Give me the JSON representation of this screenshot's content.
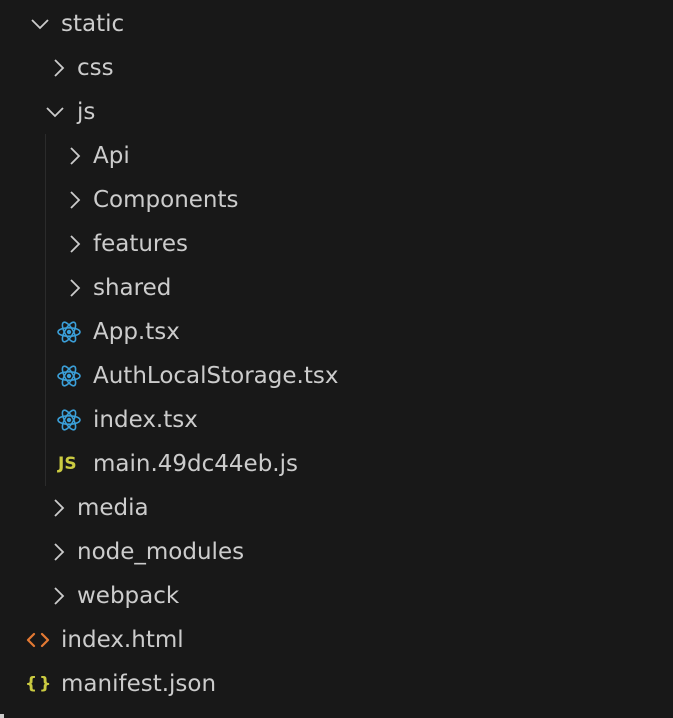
{
  "explorer": {
    "colors": {
      "background": "#181818",
      "text": "#cccccc",
      "react_icon": "#3b9fd8",
      "js_icon": "#cbcb41",
      "html_icon": "#e37933",
      "json_icon": "#cbcb41"
    },
    "items": [
      {
        "label": "static",
        "kind": "folder",
        "state": "expanded"
      },
      {
        "label": "css",
        "kind": "folder",
        "state": "collapsed"
      },
      {
        "label": "js",
        "kind": "folder",
        "state": "expanded"
      },
      {
        "label": "Api",
        "kind": "folder",
        "state": "collapsed"
      },
      {
        "label": "Components",
        "kind": "folder",
        "state": "collapsed"
      },
      {
        "label": "features",
        "kind": "folder",
        "state": "collapsed"
      },
      {
        "label": "shared",
        "kind": "folder",
        "state": "collapsed"
      },
      {
        "label": "App.tsx",
        "kind": "file",
        "icon": "react-icon"
      },
      {
        "label": "AuthLocalStorage.tsx",
        "kind": "file",
        "icon": "react-icon"
      },
      {
        "label": "index.tsx",
        "kind": "file",
        "icon": "react-icon"
      },
      {
        "label": "main.49dc44eb.js",
        "kind": "file",
        "icon": "js-icon",
        "icon_text": "JS"
      },
      {
        "label": "media",
        "kind": "folder",
        "state": "collapsed"
      },
      {
        "label": "node_modules",
        "kind": "folder",
        "state": "collapsed"
      },
      {
        "label": "webpack",
        "kind": "folder",
        "state": "collapsed"
      },
      {
        "label": "index.html",
        "kind": "file",
        "icon": "html-icon",
        "icon_text": "<>"
      },
      {
        "label": "manifest.json",
        "kind": "file",
        "icon": "json-icon",
        "icon_text": "{}"
      }
    ]
  }
}
